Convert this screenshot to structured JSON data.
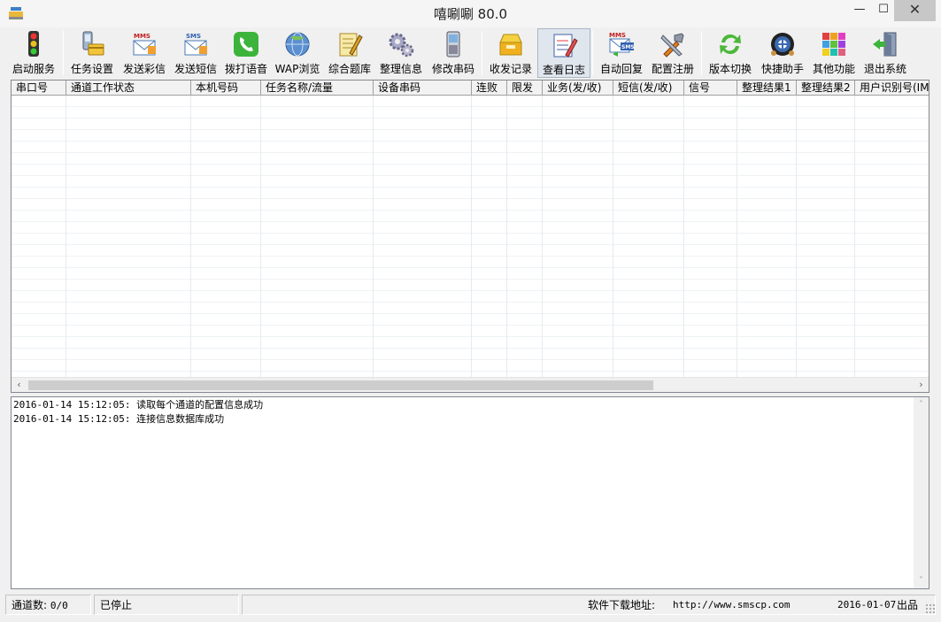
{
  "window": {
    "title": "嘻唰唰 80.0",
    "minimize": "—",
    "maximize": "☐",
    "close": "✕"
  },
  "toolbar": {
    "items": [
      {
        "label": "启动服务",
        "icon": "traffic-light-icon"
      },
      {
        "label": "任务设置",
        "icon": "phone-card-icon"
      },
      {
        "label": "发送彩信",
        "icon": "mms-envelope-icon"
      },
      {
        "label": "发送短信",
        "icon": "sms-envelope-icon"
      },
      {
        "label": "拨打语音",
        "icon": "phone-call-icon"
      },
      {
        "label": "WAP浏览",
        "icon": "globe-icon"
      },
      {
        "label": "综合题库",
        "icon": "notepad-pencil-icon"
      },
      {
        "label": "整理信息",
        "icon": "gears-icon"
      },
      {
        "label": "修改串码",
        "icon": "mobile-phone-icon"
      },
      {
        "label": "收发记录",
        "icon": "inbox-tray-icon"
      },
      {
        "label": "查看日志",
        "icon": "log-notebook-icon"
      },
      {
        "label": "自动回复",
        "icon": "mms-sms-reply-icon"
      },
      {
        "label": "配置注册",
        "icon": "tools-icon"
      },
      {
        "label": "版本切换",
        "icon": "refresh-arrows-icon"
      },
      {
        "label": "快捷助手",
        "icon": "lifebuoy-icon"
      },
      {
        "label": "其他功能",
        "icon": "color-grid-icon"
      },
      {
        "label": "退出系统",
        "icon": "exit-door-icon"
      }
    ],
    "active_index": 10
  },
  "grid": {
    "columns": [
      "串口号",
      "通道工作状态",
      "本机号码",
      "任务名称/流量",
      "设备串码",
      "连败",
      "限发",
      "业务(发/收)",
      "短信(发/收)",
      "信号",
      "整理结果1",
      "整理结果2",
      "用户识别号(IM"
    ],
    "rows": []
  },
  "scroll": {
    "left_arrow": "‹",
    "right_arrow": "›",
    "up_arrow": "˄",
    "down_arrow": "˅"
  },
  "log": {
    "lines": [
      "2016-01-14 15:12:05: 读取每个通道的配置信息成功",
      "2016-01-14 15:12:05: 连接信息数据库成功"
    ]
  },
  "status": {
    "channel_label": "通道数:",
    "channel_value": "0/0",
    "service_state": "已停止",
    "download_label": "软件下载地址:",
    "download_url": "http://www.smscp.com",
    "release_date": "2016-01-07",
    "release_suffix": "出品"
  }
}
